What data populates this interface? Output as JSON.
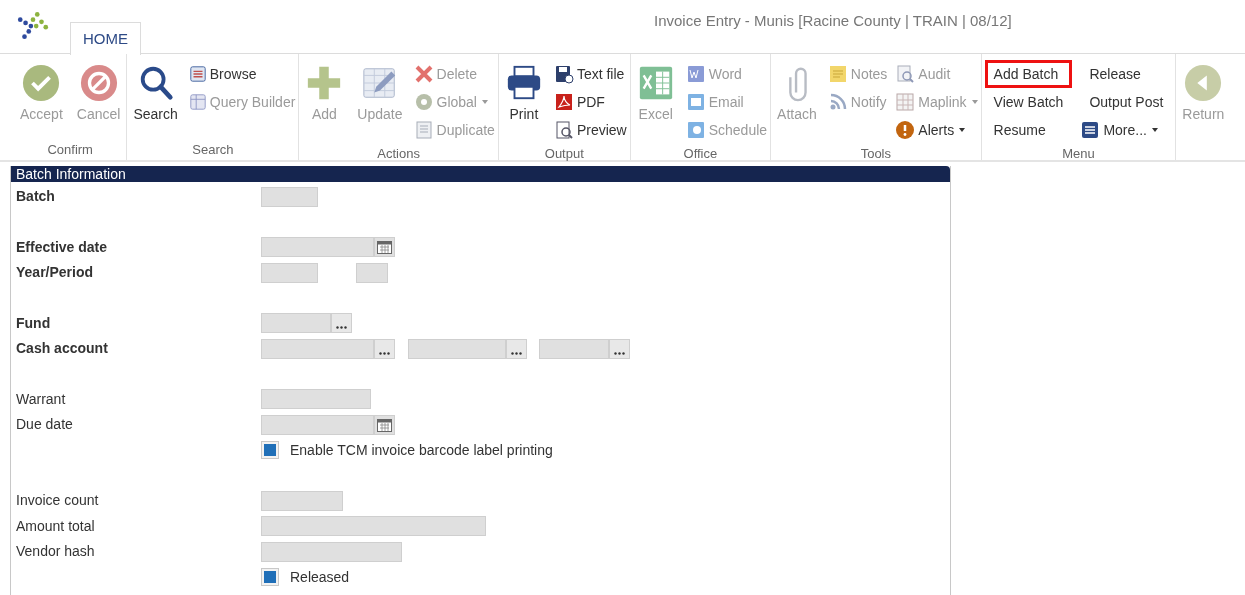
{
  "window": {
    "title": "Invoice Entry - Munis [Racine County | TRAIN | 08/12]"
  },
  "tabs": [
    {
      "label": "HOME",
      "selected": true
    }
  ],
  "ribbon": {
    "groups": [
      {
        "label": "Confirm",
        "columns": [
          [
            {
              "kind": "large",
              "label": "Accept",
              "disabled": true
            }
          ],
          [
            {
              "kind": "large",
              "label": "Cancel",
              "disabled": true
            }
          ]
        ]
      },
      {
        "label": "Search",
        "columns": [
          [
            {
              "kind": "large",
              "label": "Search",
              "disabled": false
            }
          ],
          [
            {
              "kind": "small",
              "label": "Browse",
              "disabled": false
            },
            {
              "kind": "small",
              "label": "Query Builder",
              "disabled": true
            }
          ]
        ]
      },
      {
        "label": "Actions",
        "columns": [
          [
            {
              "kind": "large",
              "label": "Add",
              "disabled": true
            }
          ],
          [
            {
              "kind": "large",
              "label": "Update",
              "disabled": true
            }
          ],
          [
            {
              "kind": "small",
              "label": "Delete",
              "disabled": true
            },
            {
              "kind": "small",
              "label": "Global",
              "disabled": true,
              "dropdown": true
            },
            {
              "kind": "small",
              "label": "Duplicate",
              "disabled": true
            }
          ]
        ]
      },
      {
        "label": "Output",
        "columns": [
          [
            {
              "kind": "large",
              "label": "Print",
              "disabled": false
            }
          ],
          [
            {
              "kind": "small",
              "label": "Text file",
              "disabled": false
            },
            {
              "kind": "small",
              "label": "PDF",
              "disabled": false
            },
            {
              "kind": "small",
              "label": "Preview",
              "disabled": false
            }
          ]
        ]
      },
      {
        "label": "Office",
        "columns": [
          [
            {
              "kind": "large",
              "label": "Excel",
              "disabled": true
            }
          ],
          [
            {
              "kind": "small",
              "label": "Word",
              "disabled": true
            },
            {
              "kind": "small",
              "label": "Email",
              "disabled": true
            },
            {
              "kind": "small",
              "label": "Schedule",
              "disabled": true
            }
          ]
        ]
      },
      {
        "label": "Tools",
        "columns": [
          [
            {
              "kind": "large",
              "label": "Attach",
              "disabled": true
            }
          ],
          [
            {
              "kind": "small",
              "label": "Notes",
              "disabled": true
            },
            {
              "kind": "small",
              "label": "Notify",
              "disabled": true
            }
          ],
          [
            {
              "kind": "small",
              "label": "Audit",
              "disabled": true
            },
            {
              "kind": "small",
              "label": "Maplink",
              "disabled": true,
              "dropdown": true
            },
            {
              "kind": "small",
              "label": "Alerts",
              "disabled": false,
              "dropdown": true
            }
          ]
        ]
      },
      {
        "label": "Menu",
        "columns": [
          [
            {
              "kind": "text",
              "label": "Add Batch",
              "disabled": false,
              "highlighted": true
            },
            {
              "kind": "text",
              "label": "View Batch",
              "disabled": false,
              "highlighted": false
            },
            {
              "kind": "text",
              "label": "Resume",
              "disabled": false,
              "highlighted": false
            }
          ],
          [
            {
              "kind": "text",
              "label": "Release",
              "disabled": false,
              "highlighted": false
            },
            {
              "kind": "text",
              "label": "Output Post",
              "disabled": false,
              "highlighted": false
            },
            {
              "kind": "small",
              "label": "More...",
              "disabled": false,
              "dropdown": true
            }
          ]
        ]
      },
      {
        "columns": [
          [
            {
              "kind": "large",
              "label": "Return",
              "disabled": true
            }
          ]
        ]
      }
    ]
  },
  "panel": {
    "title": "Batch Information",
    "groups": [
      [
        {
          "kind": "field",
          "label": "Batch",
          "bold": true,
          "controls": [
            {
              "kind": "text"
            }
          ]
        }
      ],
      [
        {
          "kind": "field",
          "label": "Effective date",
          "bold": true,
          "controls": [
            {
              "kind": "date"
            }
          ]
        },
        {
          "kind": "field",
          "label": "Year/Period",
          "bold": true,
          "controls": [
            {
              "kind": "text"
            },
            {
              "kind": "text"
            }
          ]
        }
      ],
      [
        {
          "kind": "field",
          "label": "Fund",
          "bold": true,
          "controls": [
            {
              "kind": "lookup"
            }
          ]
        },
        {
          "kind": "field",
          "label": "Cash account",
          "bold": true,
          "controls": [
            {
              "kind": "lookup"
            },
            {
              "kind": "lookup"
            },
            {
              "kind": "lookup"
            }
          ]
        }
      ],
      [
        {
          "kind": "field",
          "label": "Warrant",
          "bold": false,
          "controls": [
            {
              "kind": "text"
            }
          ]
        },
        {
          "kind": "field",
          "label": "Due date",
          "bold": false,
          "controls": [
            {
              "kind": "date"
            }
          ]
        },
        {
          "kind": "checkbox",
          "label": "Enable TCM invoice barcode label printing",
          "checked": true
        }
      ],
      [
        {
          "kind": "field",
          "label": "Invoice count",
          "bold": false,
          "controls": [
            {
              "kind": "text"
            }
          ]
        },
        {
          "kind": "field",
          "label": "Amount total",
          "bold": false,
          "controls": [
            {
              "kind": "text"
            }
          ]
        },
        {
          "kind": "field",
          "label": "Vendor hash",
          "bold": false,
          "controls": [
            {
              "kind": "text"
            }
          ]
        },
        {
          "kind": "checkbox",
          "label": "Released",
          "checked": true
        }
      ]
    ]
  }
}
